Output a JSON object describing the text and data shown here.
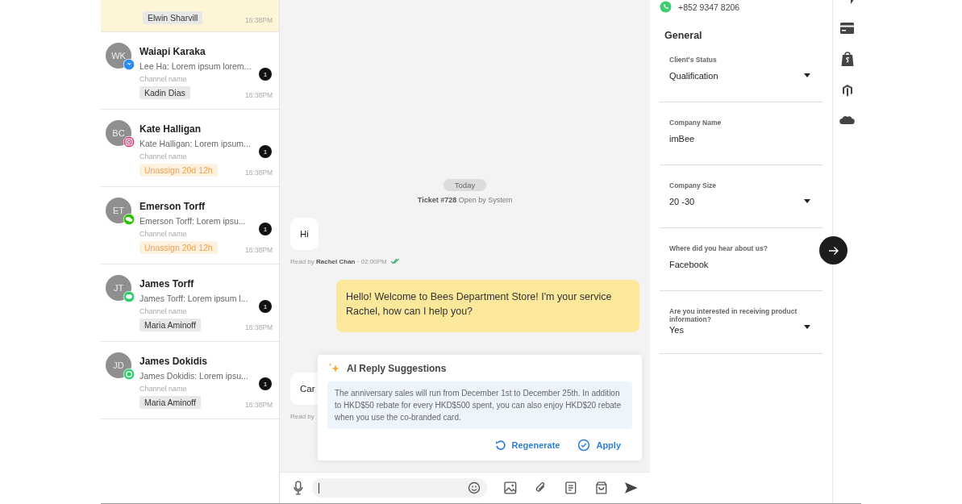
{
  "conversations": [
    {
      "selected": true,
      "tag": {
        "text": "Elwin Sharvill",
        "kind": "agent"
      },
      "time": "16:38PM"
    },
    {
      "selected": false,
      "initials": "WK",
      "kind": "messenger",
      "name": "Waiapi Karaka",
      "preview": "Lee Ha: Lorem ipsum lorem...",
      "channel_name": "Channel name",
      "tag": {
        "text": "Kadin Dias",
        "kind": "agent"
      },
      "unread": "1",
      "time": "16:38PM"
    },
    {
      "selected": false,
      "initials": "BC",
      "kind": "instagram",
      "name": "Kate Halligan",
      "preview": "Kate Halligan: Lorem ipsum...",
      "channel_name": "Channel name",
      "tag": {
        "text": "Unassign 20d 12h",
        "kind": "unassigned"
      },
      "unread": "1",
      "time": "16:38PM"
    },
    {
      "selected": false,
      "initials": "ET",
      "kind": "wechat",
      "name": "Emerson Torff",
      "preview": "Emerson Torff: Lorem ipsu...",
      "channel_name": "Channel name",
      "tag": {
        "text": "Unassign 20d 12h",
        "kind": "unassigned"
      },
      "unread": "1",
      "time": "16:38PM"
    },
    {
      "selected": false,
      "initials": "JT",
      "kind": "line",
      "name": "James Torff",
      "preview": "James Torff: Lorem ipsum l...",
      "channel_name": "Channel name",
      "tag": {
        "text": "Maria Aminoff",
        "kind": "agent"
      },
      "unread": "1",
      "time": "16:38PM"
    },
    {
      "selected": false,
      "initials": "JD",
      "kind": "whatsapp",
      "name": "James Dokidis",
      "preview": "James Dokidis: Lorem ipsu...",
      "channel_name": "Channel name",
      "tag": {
        "text": "Maria Aminoff",
        "kind": "agent"
      },
      "unread": "1",
      "time": "16:38PM"
    }
  ],
  "chat": {
    "date_chip": "Today",
    "ticket_note": "**Ticket #728** Open by System",
    "messages": [
      {
        "kind": "incoming",
        "text": "Hi",
        "receipt": "Read by **Rachel Chan** · 02:00PM",
        "read": true
      },
      {
        "kind": "outgoing",
        "text": "Hello! Welcome to Bees Department Store! I'm your service Rachel, how can I help you?"
      },
      {
        "kind": "incoming",
        "text": "Car",
        "receipt": "Read by"
      }
    ]
  },
  "ai_suggestion": {
    "title": "AI Reply Suggestions",
    "text": "The anniversary sales will run from December 1st to December 25th. In addition to HKD$50 rebate for every HKD$500 spent, you can also enjoy HKD$20 rebate when you use the co-branded card.",
    "actions": [
      {
        "label": "Regenerate",
        "kind": "regenerate"
      },
      {
        "label": "Apply",
        "kind": "apply"
      }
    ]
  },
  "contact": {
    "phone": "+852 9347 8206"
  },
  "general": {
    "title": "General",
    "fields": [
      {
        "label": "Client's Status",
        "value": "Qualification",
        "kind": "select"
      },
      {
        "label": "Company Name",
        "value": "imBee",
        "kind": "text"
      },
      {
        "label": "Company Size",
        "value": "20 -30",
        "kind": "select"
      },
      {
        "label": "Where did you hear about us?",
        "value": "Facebook",
        "kind": "text"
      },
      {
        "label": "Are you interested in receiving product information?",
        "value": "Yes",
        "kind": "select"
      }
    ]
  }
}
